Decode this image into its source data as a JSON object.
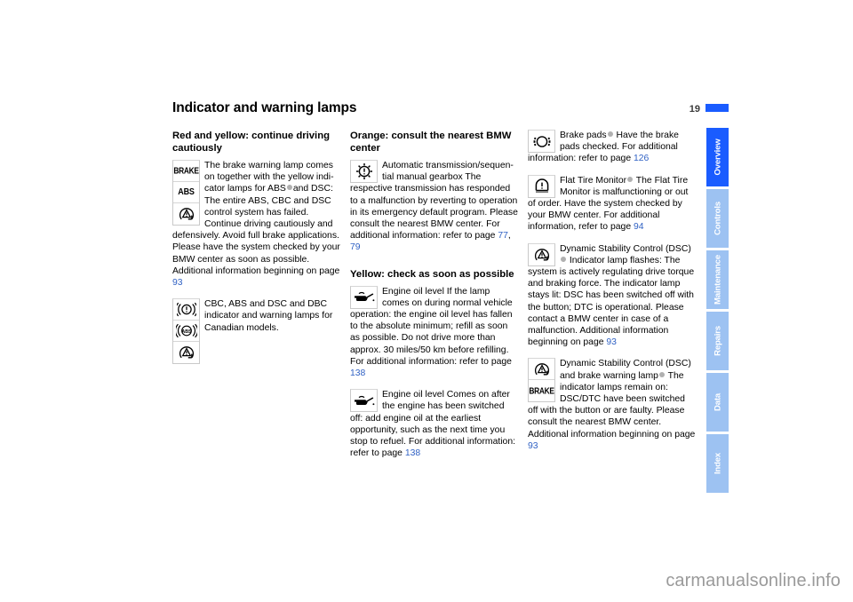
{
  "document": {
    "title": "Indicator and warning lamps",
    "page_number": "19",
    "watermark": "carmanualsonline.info"
  },
  "left_column": {
    "heading": "Red and yellow: continue driving cautiously",
    "block1": {
      "icons": [
        "BRAKE",
        "ABS",
        "dsc-triangle-icon"
      ],
      "text_1": "The brake warning lamp comes on together with the yellow indi-cator lamps for ABS",
      "text_2": "and DSC:",
      "text_3": "The entire ABS, CBC and DSC control system has failed. Continue driving cautiously and defensively. Avoid full brake applications. Please have the system checked by your BMW center as soon as possible.",
      "text_4": "Additional information beginning on page",
      "ref_page": "93"
    },
    "block2": {
      "icons": [
        "((!))",
        "((ABS))",
        "dsc-triangle-icon"
      ],
      "text": "CBC, ABS and DSC and DBC indicator and warning lamps for Canadian models."
    }
  },
  "middle_column": {
    "heading_orange": "Orange: consult the nearest BMW center",
    "block1": {
      "icon": "gear-exclamation-icon",
      "title": "Automatic transmission/sequen-tial manual gearbox",
      "body": "The respective transmission has responded to a malfunction by reverting to operation in its emergency default program. Please consult the nearest BMW center.",
      "ref_label": "For additional information: refer to page",
      "ref_page_1": "77",
      "ref_sep": ", ",
      "ref_page_2": "79"
    },
    "heading_yellow": "Yellow: check as soon as possible",
    "block2": {
      "icon": "oil-can-icon",
      "title": "Engine oil level",
      "body": "If the lamp comes on during normal vehicle operation: the engine oil level has fallen to the absolute minimum; refill as soon as possible. Do not drive more than approx. 30 miles/50 km before refilling.",
      "ref_label": "For additional information: refer to page",
      "ref_page": "138"
    },
    "block3": {
      "icon": "oil-can-icon",
      "title": "Engine oil level",
      "body": "Comes on after the engine has been switched off: add engine oil at the earliest opportunity, such as the next time you stop to refuel.",
      "ref_label": "For additional information: refer to page",
      "ref_page": "138"
    }
  },
  "right_column": {
    "block1": {
      "icon": "brake-pads-icon",
      "title": "Brake pads",
      "body": "Have the brake pads checked.",
      "ref_label": "For additional information: refer to page",
      "ref_page": "126"
    },
    "block2": {
      "icon": "flat-tire-icon",
      "title": "Flat Tire Monitor",
      "body": "The Flat Tire Monitor is malfunctioning or out of order. Have the system checked by your BMW center.",
      "ref_label": "For additional information, refer to page",
      "ref_page": "94"
    },
    "block3": {
      "icon": "dsc-triangle-icon",
      "title_line1": "Dynamic Stability Control",
      "title_line2": "(DSC)",
      "body": "Indicator lamp flashes: The system is actively regulating drive torque and braking force. The indicator lamp stays lit: DSC has been switched off with the button; DTC is operational. Please contact a BMW center in case of a malfunction.",
      "ref_label": "Additional information beginning on page",
      "ref_page": "93"
    },
    "block4": {
      "icons": [
        "dsc-triangle-icon",
        "BRAKE"
      ],
      "title": "Dynamic Stability Control (DSC) and brake warning lamp",
      "body": "The indicator lamps remain on: DSC/DTC have been switched off with the button or are faulty. Please consult the nearest BMW center.",
      "ref_label": "Additional information beginning on page",
      "ref_page": "93"
    }
  },
  "tabs": [
    {
      "label": "Overview",
      "active": true
    },
    {
      "label": "Controls",
      "active": false
    },
    {
      "label": "Maintenance",
      "active": false
    },
    {
      "label": "Repairs",
      "active": false
    },
    {
      "label": "Data",
      "active": false
    },
    {
      "label": "Index",
      "active": false
    }
  ],
  "colors": {
    "accent_blue": "#1a5cff",
    "tab_inactive": "#9dc2f2",
    "ref_link": "#3162c4",
    "dot_gray": "#b0b0b0"
  }
}
